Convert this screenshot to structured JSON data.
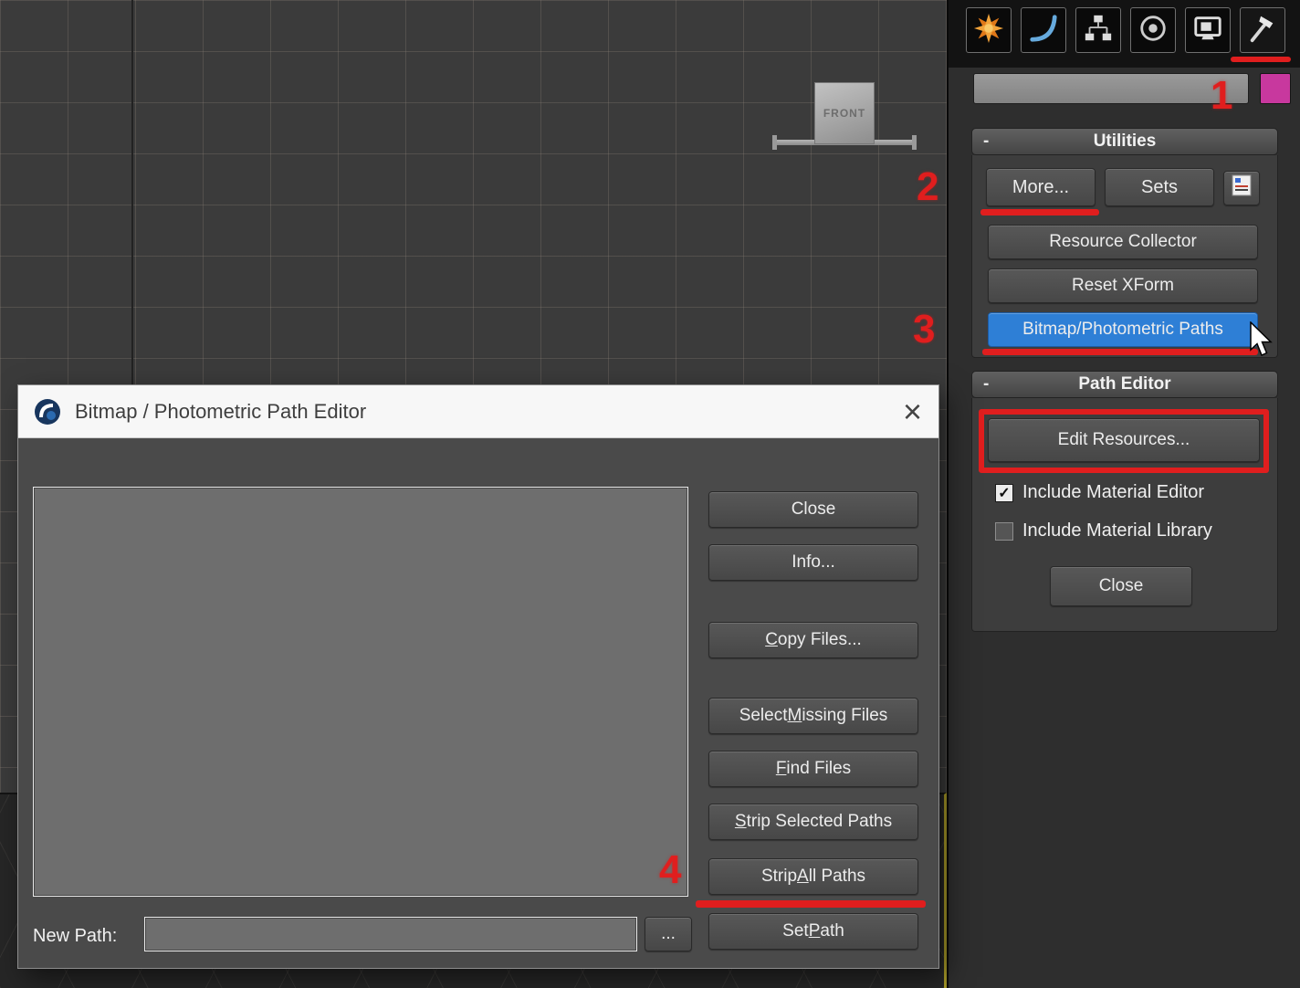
{
  "colors": {
    "accent_blue": "#2e7fd6",
    "annotation_red": "#e01e1e",
    "swatch_magenta": "#c8389e",
    "viewport_active_border": "#a89a28"
  },
  "viewport": {
    "front_gizmo_label": "FRONT"
  },
  "command_panel": {
    "tabs": [
      {
        "icon": "create-icon",
        "selected": false
      },
      {
        "icon": "modify-icon",
        "selected": false
      },
      {
        "icon": "hierarchy-icon",
        "selected": false
      },
      {
        "icon": "motion-icon",
        "selected": false
      },
      {
        "icon": "display-icon",
        "selected": false
      },
      {
        "icon": "utilities-icon",
        "selected": true
      }
    ],
    "name_field": {
      "value": ""
    },
    "utilities_rollout": {
      "title": "Utilities",
      "collapse_glyph": "-",
      "more_button": "More...",
      "sets_button": "Sets",
      "buttons": [
        "Resource Collector",
        "Reset XForm",
        "Bitmap/Photometric Paths"
      ]
    },
    "path_editor_rollout": {
      "title": "Path Editor",
      "collapse_glyph": "-",
      "edit_resources_button": "Edit Resources...",
      "checkbox_material_editor": {
        "label": "Include Material Editor",
        "checked": true,
        "glyph": "✓"
      },
      "checkbox_material_library": {
        "label": "Include Material Library",
        "checked": false,
        "glyph": ""
      },
      "close_button": "Close"
    }
  },
  "dialog": {
    "title": "Bitmap / Photometric Path Editor",
    "close_glyph": "×",
    "list_items": [],
    "buttons": [
      {
        "label": "Close",
        "accel": -1
      },
      {
        "label": "Info...",
        "accel": -1
      },
      {
        "label": "Copy Files...",
        "accel": 0
      },
      {
        "label": "Select Missing Files",
        "accel": 7
      },
      {
        "label": "Find Files",
        "accel": 0
      },
      {
        "label": "Strip Selected Paths",
        "accel": 0
      },
      {
        "label": "Strip All Paths",
        "accel": 6
      },
      {
        "label": "Set Path",
        "accel": 4
      }
    ],
    "new_path_label": "New Path:",
    "new_path_value": "",
    "browse_button": "..."
  },
  "annotations": {
    "step_1": "1",
    "step_2": "2",
    "step_3": "3",
    "step_4": "4"
  }
}
